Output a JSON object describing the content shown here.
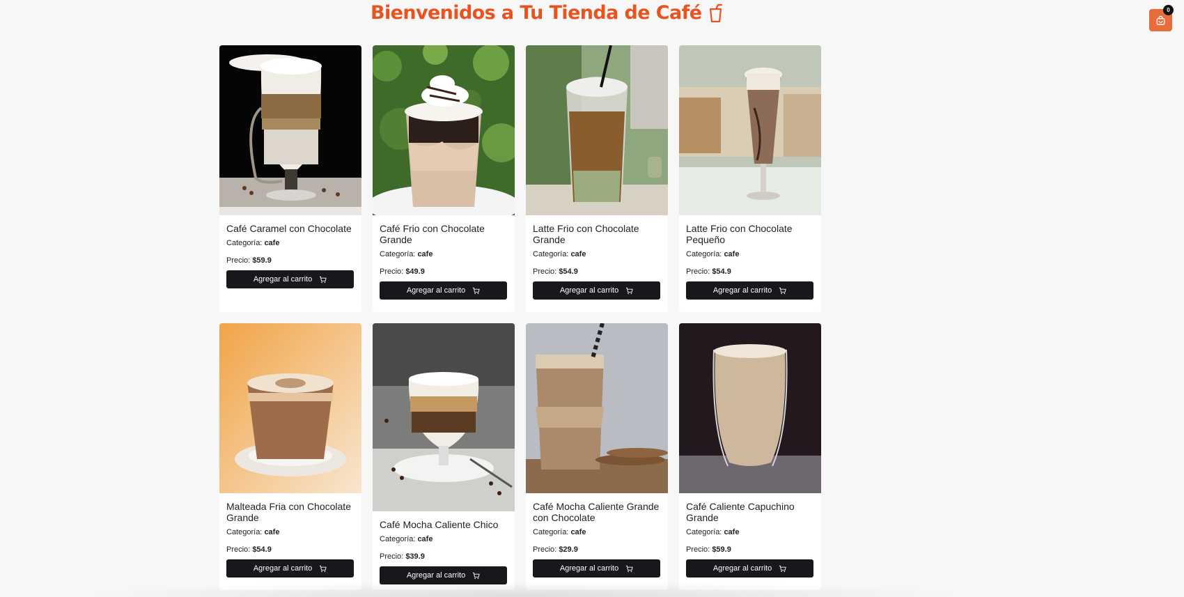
{
  "header": {
    "title": "Bienvenidos a Tu Tienda de Café",
    "title_icon": "cup-icon",
    "accent_color": "#e8531f"
  },
  "cart": {
    "icon": "shopping-bag-icon",
    "count": "0",
    "button_color": "#e96d3c"
  },
  "labels": {
    "category_prefix": "Categoría:",
    "price_prefix": "Precio:",
    "add_to_cart": "Agregar al carrito",
    "add_to_cart_icon": "cart-icon"
  },
  "products": [
    {
      "name": "Café Caramel con Chocolate",
      "category": "cafe",
      "price": "$59.9",
      "photo": "layered caramel coffee in tall glass"
    },
    {
      "name": "Café Frio con Chocolate Grande",
      "category": "cafe",
      "price": "$49.9",
      "photo": "iced chocolate coffee with whipped cream"
    },
    {
      "name": "Latte Frio con Chocolate Grande",
      "category": "cafe",
      "price": "$54.9",
      "photo": "iced latte in plastic cup with straw"
    },
    {
      "name": "Latte Frio con Chocolate Pequeño",
      "category": "cafe",
      "price": "$54.9",
      "photo": "chocolate latte in tall glass"
    },
    {
      "name": "Malteada Fria con Chocolate Grande",
      "category": "cafe",
      "price": "$54.9",
      "photo": "latte in glass cup on saucer"
    },
    {
      "name": "Café Mocha Caliente Chico",
      "category": "cafe",
      "price": "$39.9",
      "photo": "layered mocha in small glass on saucer"
    },
    {
      "name": "Café Mocha Caliente Grande con Chocolate",
      "category": "cafe",
      "price": "$29.9",
      "photo": "iced mocha in glass with striped straw and cookies"
    },
    {
      "name": "Café Caliente Capuchino Grande",
      "category": "cafe",
      "price": "$59.9",
      "photo": "cappuccino in double wall glass"
    }
  ]
}
